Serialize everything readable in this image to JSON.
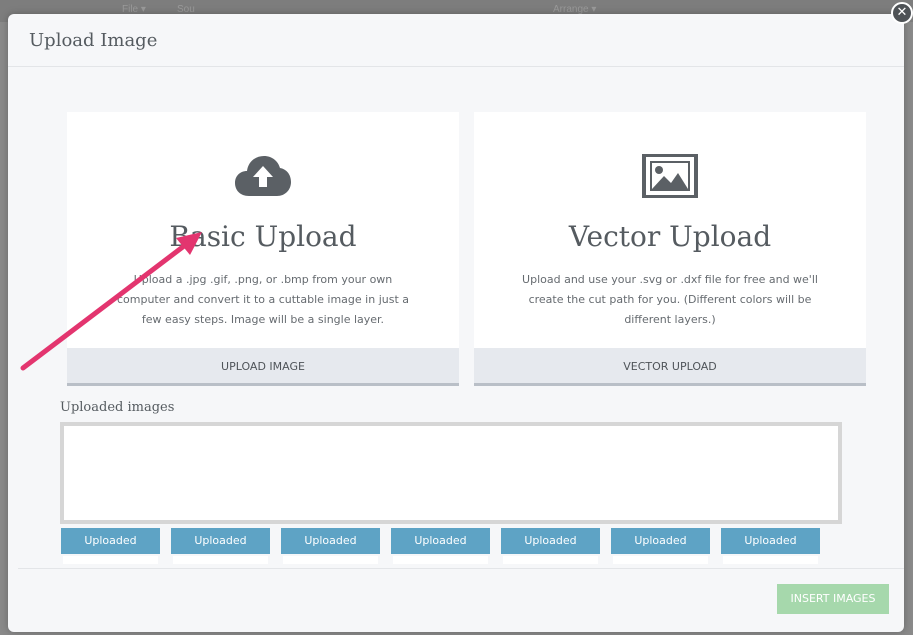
{
  "background_menu": {
    "items": [
      "File ▾",
      "Sou",
      "Arrange ▾"
    ]
  },
  "modal": {
    "title": "Upload Image",
    "close_icon": "close-icon"
  },
  "basic": {
    "icon": "cloud-upload-icon",
    "title": "Basic Upload",
    "description": "Upload a .jpg .gif, .png, or .bmp from your own computer and convert it to a cuttable image in just a few easy steps. Image will be a single layer.",
    "button_label": "UPLOAD IMAGE"
  },
  "vector": {
    "icon": "image-icon",
    "title": "Vector Upload",
    "description": "Upload and use your .svg or .dxf file for free and we'll create the cut path for you. (Different colors will be different layers.)",
    "button_label": "VECTOR UPLOAD"
  },
  "uploaded": {
    "label": "Uploaded images",
    "buttons": [
      "Uploaded",
      "Uploaded",
      "Uploaded",
      "Uploaded",
      "Uploaded",
      "Uploaded",
      "Uploaded"
    ]
  },
  "footer": {
    "insert_label": "INSERT IMAGES"
  },
  "annotation": {
    "arrow_icon": "pointer-arrow-icon",
    "color": "#e3356f"
  },
  "colors": {
    "uploaded_button": "#5ea3c5",
    "insert_button": "#a6d8ac",
    "card_button": "#e6e9ee"
  }
}
